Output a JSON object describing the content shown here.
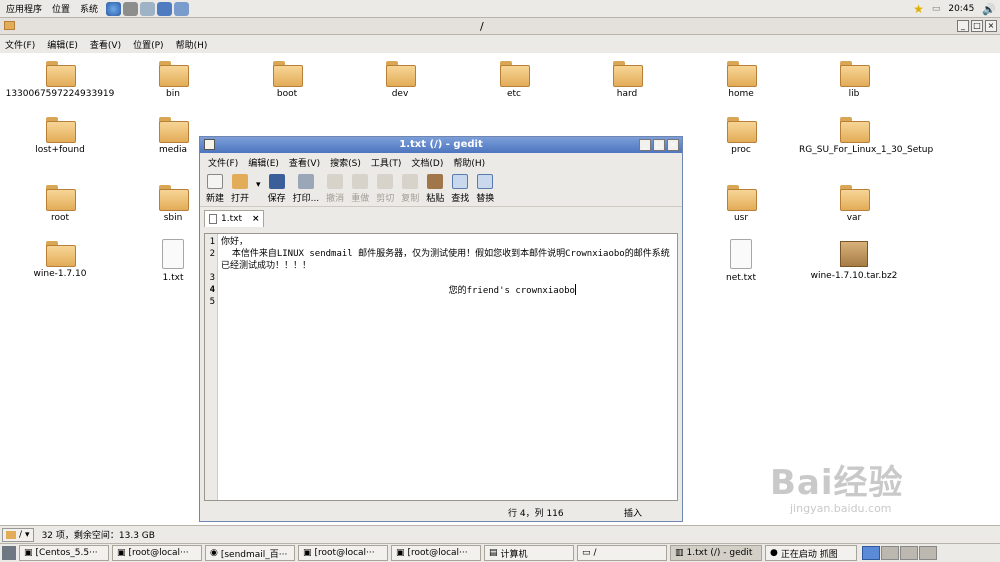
{
  "topbar": {
    "menus": [
      "应用程序",
      "位置",
      "系统"
    ],
    "launchers": [
      "browser-icon",
      "network-icon",
      "editor-icon",
      "monitor-icon",
      "mail-icon"
    ],
    "clock": "20:45"
  },
  "file_manager": {
    "title": "/",
    "menus": [
      "文件(F)",
      "编辑(E)",
      "查看(V)",
      "位置(P)",
      "帮助(H)"
    ],
    "icons": [
      {
        "label": "1330067597224933919",
        "kind": "folder"
      },
      {
        "label": "bin",
        "kind": "folder"
      },
      {
        "label": "boot",
        "kind": "folder"
      },
      {
        "label": "dev",
        "kind": "folder"
      },
      {
        "label": "etc",
        "kind": "folder"
      },
      {
        "label": "hard",
        "kind": "folder"
      },
      {
        "label": "home",
        "kind": "folder"
      },
      {
        "label": "lib",
        "kind": "folder"
      },
      {
        "label": "lost+found",
        "kind": "folder"
      },
      {
        "label": "media",
        "kind": "folder"
      },
      {
        "label": "proc",
        "kind": "folder"
      },
      {
        "label": "RG_SU_For_Linux_1_30_Setup",
        "kind": "folder"
      },
      {
        "label": "root",
        "kind": "folder"
      },
      {
        "label": "sbin",
        "kind": "folder"
      },
      {
        "label": "usr",
        "kind": "folder"
      },
      {
        "label": "var",
        "kind": "folder"
      },
      {
        "label": "wine-1.7.10",
        "kind": "folder"
      },
      {
        "label": "1.txt",
        "kind": "text"
      },
      {
        "label": "net.txt",
        "kind": "text"
      },
      {
        "label": "wine-1.7.10.tar.bz2",
        "kind": "archive"
      }
    ],
    "status": "32 项，剩余空间：13.3 GB",
    "location": "/"
  },
  "gedit": {
    "title": "1.txt (/) - gedit",
    "menus": [
      "文件(F)",
      "编辑(E)",
      "查看(V)",
      "搜索(S)",
      "工具(T)",
      "文档(D)",
      "帮助(H)"
    ],
    "toolbar": {
      "new": "新建",
      "open": "打开",
      "save": "保存",
      "print": "打印...",
      "undo": "撤消",
      "redo": "重做",
      "cut": "剪切",
      "copy": "复制",
      "paste": "粘贴",
      "find": "查找",
      "replace": "替换"
    },
    "tab_label": "1.txt",
    "line_numbers": [
      "1",
      "2",
      "3",
      "4",
      "5"
    ],
    "lines": [
      "你好，",
      "  本信件来自LINUX sendmail 邮件服务器，仅为测试使用！假如您收到本邮件说明Crownxiaobo的邮件系统已经测试成功！！！！",
      "",
      "                                          您的friend's crownxiaobo",
      ""
    ],
    "position": "行 4，列 116",
    "mode": "插入"
  },
  "taskbar": [
    {
      "label": "[Centos_5.5···",
      "active": false
    },
    {
      "label": "[root@local···",
      "active": false
    },
    {
      "label": "[sendmail_百···",
      "active": false
    },
    {
      "label": "[root@local···",
      "active": false
    },
    {
      "label": "[root@local···",
      "active": false
    },
    {
      "label": "计算机",
      "active": false
    },
    {
      "label": "/",
      "active": false
    },
    {
      "label": "1.txt (/) - gedit",
      "active": true
    },
    {
      "label": "正在启动 抓图",
      "active": false
    }
  ],
  "watermark": {
    "brand": "Bai经验",
    "url": "jingyan.baidu.com"
  },
  "colors": {
    "titlebar": "#4d75bf",
    "folder": "#e2ac58"
  }
}
